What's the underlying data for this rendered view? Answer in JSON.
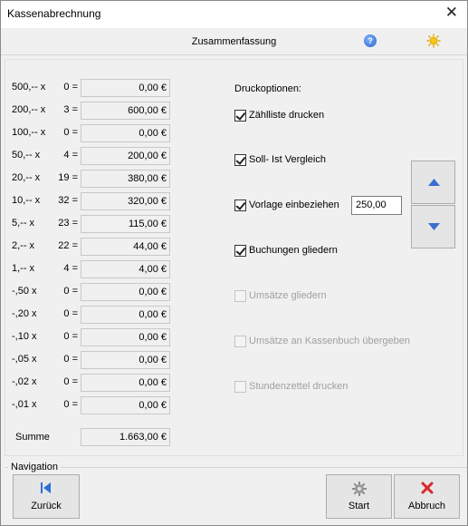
{
  "window": {
    "title": "Kassenabrechnung"
  },
  "header": {
    "title": "Zusammenfassung"
  },
  "denominations": [
    {
      "label": "500,-- x",
      "count": "0 =",
      "value": "0,00 €"
    },
    {
      "label": "200,-- x",
      "count": "3 =",
      "value": "600,00 €"
    },
    {
      "label": "100,-- x",
      "count": "0 =",
      "value": "0,00 €"
    },
    {
      "label": "50,-- x",
      "count": "4 =",
      "value": "200,00 €"
    },
    {
      "label": "20,-- x",
      "count": "19 =",
      "value": "380,00 €"
    },
    {
      "label": "10,-- x",
      "count": "32 =",
      "value": "320,00 €"
    },
    {
      "label": "5,-- x",
      "count": "23 =",
      "value": "115,00 €"
    },
    {
      "label": "2,-- x",
      "count": "22 =",
      "value": "44,00 €"
    },
    {
      "label": "1,-- x",
      "count": "4 =",
      "value": "4,00 €"
    },
    {
      "label": "-,50 x",
      "count": "0 =",
      "value": "0,00 €"
    },
    {
      "label": "-,20 x",
      "count": "0 =",
      "value": "0,00 €"
    },
    {
      "label": "-,10 x",
      "count": "0 =",
      "value": "0,00 €"
    },
    {
      "label": "-,05 x",
      "count": "0 =",
      "value": "0,00 €"
    },
    {
      "label": "-,02 x",
      "count": "0 =",
      "value": "0,00 €"
    },
    {
      "label": "-,01 x",
      "count": "0 =",
      "value": "0,00 €"
    }
  ],
  "summe": {
    "label": "Summe",
    "value": "1.663,00 €"
  },
  "druck": {
    "label": "Druckoptionen:",
    "options": [
      {
        "label": "Zählliste drucken",
        "checked": true,
        "enabled": true
      },
      {
        "label": "Soll- Ist Vergleich",
        "checked": true,
        "enabled": true
      },
      {
        "label": "Vorlage einbeziehen",
        "checked": true,
        "enabled": true
      },
      {
        "label": "Buchungen gliedern",
        "checked": true,
        "enabled": true
      },
      {
        "label": "Umsätze gliedern",
        "checked": false,
        "enabled": false
      },
      {
        "label": "Umsätze an Kassenbuch übergeben",
        "checked": false,
        "enabled": false
      },
      {
        "label": "Stundenzettel drucken",
        "checked": false,
        "enabled": false
      }
    ],
    "vorlage_value": "250,00"
  },
  "navigation": {
    "label": "Navigation",
    "back_label": "Zurück",
    "start_label": "Start",
    "cancel_label": "Abbruch"
  },
  "colors": {
    "arrow_blue": "#3a6fd0",
    "cancel_red": "#d9262b",
    "back_blue": "#2d6fd6"
  }
}
